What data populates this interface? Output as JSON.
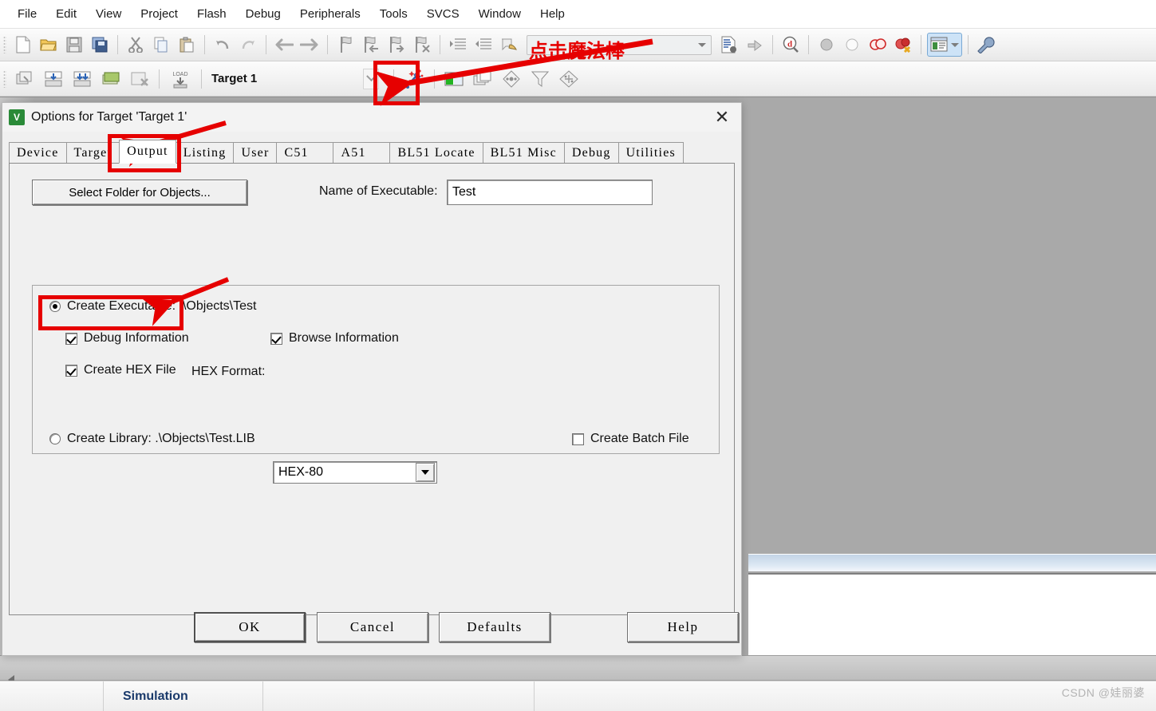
{
  "menu": {
    "items": [
      {
        "label": "File"
      },
      {
        "label": "Edit"
      },
      {
        "label": "View"
      },
      {
        "label": "Project"
      },
      {
        "label": "Flash"
      },
      {
        "label": "Debug"
      },
      {
        "label": "Peripherals"
      },
      {
        "label": "Tools"
      },
      {
        "label": "SVCS"
      },
      {
        "label": "Window"
      },
      {
        "label": "Help"
      }
    ]
  },
  "toolbar1": {
    "buttons": [
      {
        "name": "new-file-icon"
      },
      {
        "name": "open-file-icon"
      },
      {
        "name": "save-icon"
      },
      {
        "name": "save-all-icon"
      },
      {
        "name": "cut-icon"
      },
      {
        "name": "copy-icon"
      },
      {
        "name": "paste-icon"
      },
      {
        "name": "undo-icon"
      },
      {
        "name": "redo-icon"
      },
      {
        "name": "navigate-back-icon"
      },
      {
        "name": "navigate-forward-icon"
      },
      {
        "name": "bookmark-toggle-icon"
      },
      {
        "name": "bookmark-prev-icon"
      },
      {
        "name": "bookmark-next-icon"
      },
      {
        "name": "bookmark-clear-icon"
      },
      {
        "name": "indent-icon"
      },
      {
        "name": "outdent-icon"
      },
      {
        "name": "comment-icon"
      }
    ],
    "search_placeholder": "",
    "right_buttons": [
      {
        "name": "insert-file-icon"
      },
      {
        "name": "configure-icon"
      },
      {
        "name": "debug-query-icon"
      },
      {
        "name": "breakpoint-set-icon"
      },
      {
        "name": "breakpoint-clear-icon"
      },
      {
        "name": "breakpoint-disable-icon"
      },
      {
        "name": "breakpoint-kill-all-icon"
      },
      {
        "name": "window-manager-icon"
      },
      {
        "name": "options-wrench-icon"
      }
    ]
  },
  "toolbar2": {
    "buttons": [
      {
        "name": "translate-icon"
      },
      {
        "name": "build-icon"
      },
      {
        "name": "rebuild-all-icon"
      },
      {
        "name": "batch-build-icon"
      },
      {
        "name": "stop-build-icon"
      },
      {
        "name": "download-icon"
      }
    ],
    "target_value": "Target 1",
    "after_buttons": [
      {
        "name": "magic-wand-icon"
      },
      {
        "name": "project-window-icon"
      },
      {
        "name": "books-icon"
      },
      {
        "name": "source-browser-icon"
      },
      {
        "name": "find-in-files-icon"
      },
      {
        "name": "manage-components-icon"
      }
    ]
  },
  "annotations": {
    "toolbar_note": "点击魔法棒"
  },
  "dialog": {
    "title": "Options for Target 'Target 1'",
    "icon_label": "V",
    "close_label": "✕",
    "tabs": [
      {
        "label": "Device",
        "active": false
      },
      {
        "label": "Target",
        "active": false
      },
      {
        "label": "Output",
        "active": true
      },
      {
        "label": "Listing",
        "active": false
      },
      {
        "label": "User",
        "active": false
      },
      {
        "label": "C51",
        "active": false
      },
      {
        "label": "A51",
        "active": false
      },
      {
        "label": "BL51 Locate",
        "active": false
      },
      {
        "label": "BL51 Misc",
        "active": false
      },
      {
        "label": "Debug",
        "active": false
      },
      {
        "label": "Utilities",
        "active": false
      }
    ],
    "output": {
      "select_folder_button": "Select Folder for Objects...",
      "name_of_executable_label": "Name of Executable:",
      "name_of_executable_value": "Test",
      "create_executable_label": "Create Executable:  .\\Objects\\Test",
      "create_executable_checked": true,
      "debug_information_label": "Debug Information",
      "debug_information_checked": true,
      "browse_information_label": "Browse Information",
      "browse_information_checked": true,
      "create_hex_file_label": "Create HEX File",
      "create_hex_file_checked": true,
      "hex_format_label": "HEX Format:",
      "hex_format_value": "HEX-80",
      "create_library_label": "Create Library:  .\\Objects\\Test.LIB",
      "create_library_checked": false,
      "create_batch_file_label": "Create Batch File",
      "create_batch_file_checked": false
    },
    "buttons": {
      "ok": "OK",
      "cancel": "Cancel",
      "defaults": "Defaults",
      "help": "Help"
    }
  },
  "statusbar": {
    "simulation": "Simulation",
    "watermark": "CSDN @娃丽婆"
  },
  "colors": {
    "annotation_red": "#e60000",
    "dialog_face": "#f0f0f0",
    "workspace_gray": "#a9a9a9",
    "status_blue": "#1a3a6b"
  }
}
